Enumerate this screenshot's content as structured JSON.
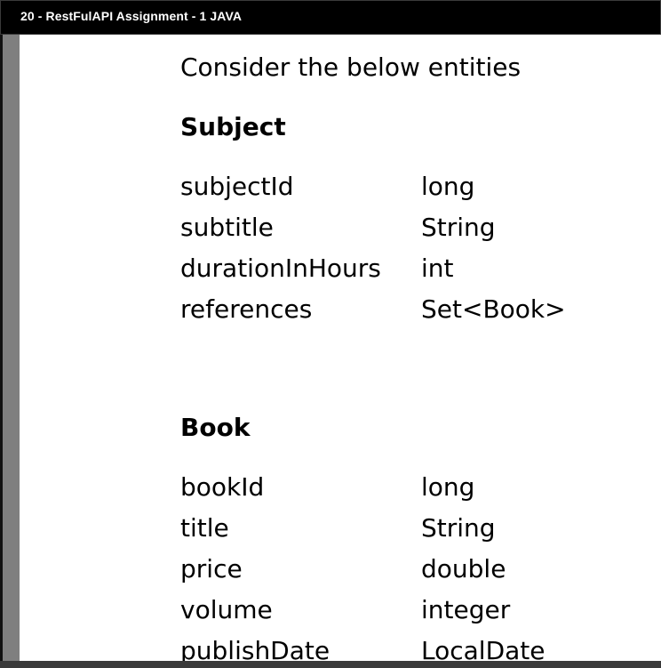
{
  "window": {
    "title": "20 - RestFulAPI Assignment - 1 JAVA"
  },
  "document": {
    "intro": "Consider the below entities",
    "entities": [
      {
        "name": "Subject",
        "fields": [
          {
            "name": "subjectId",
            "type": "long"
          },
          {
            "name": "subtitle",
            "type": "String"
          },
          {
            "name": "durationInHours",
            "type": "int"
          },
          {
            "name": "references",
            "type": "Set<Book>"
          }
        ]
      },
      {
        "name": "Book",
        "fields": [
          {
            "name": "bookId",
            "type": "long"
          },
          {
            "name": "title",
            "type": "String"
          },
          {
            "name": "price",
            "type": "double"
          },
          {
            "name": "volume",
            "type": "integer"
          },
          {
            "name": "publishDate",
            "type": "LocalDate"
          }
        ]
      }
    ]
  }
}
